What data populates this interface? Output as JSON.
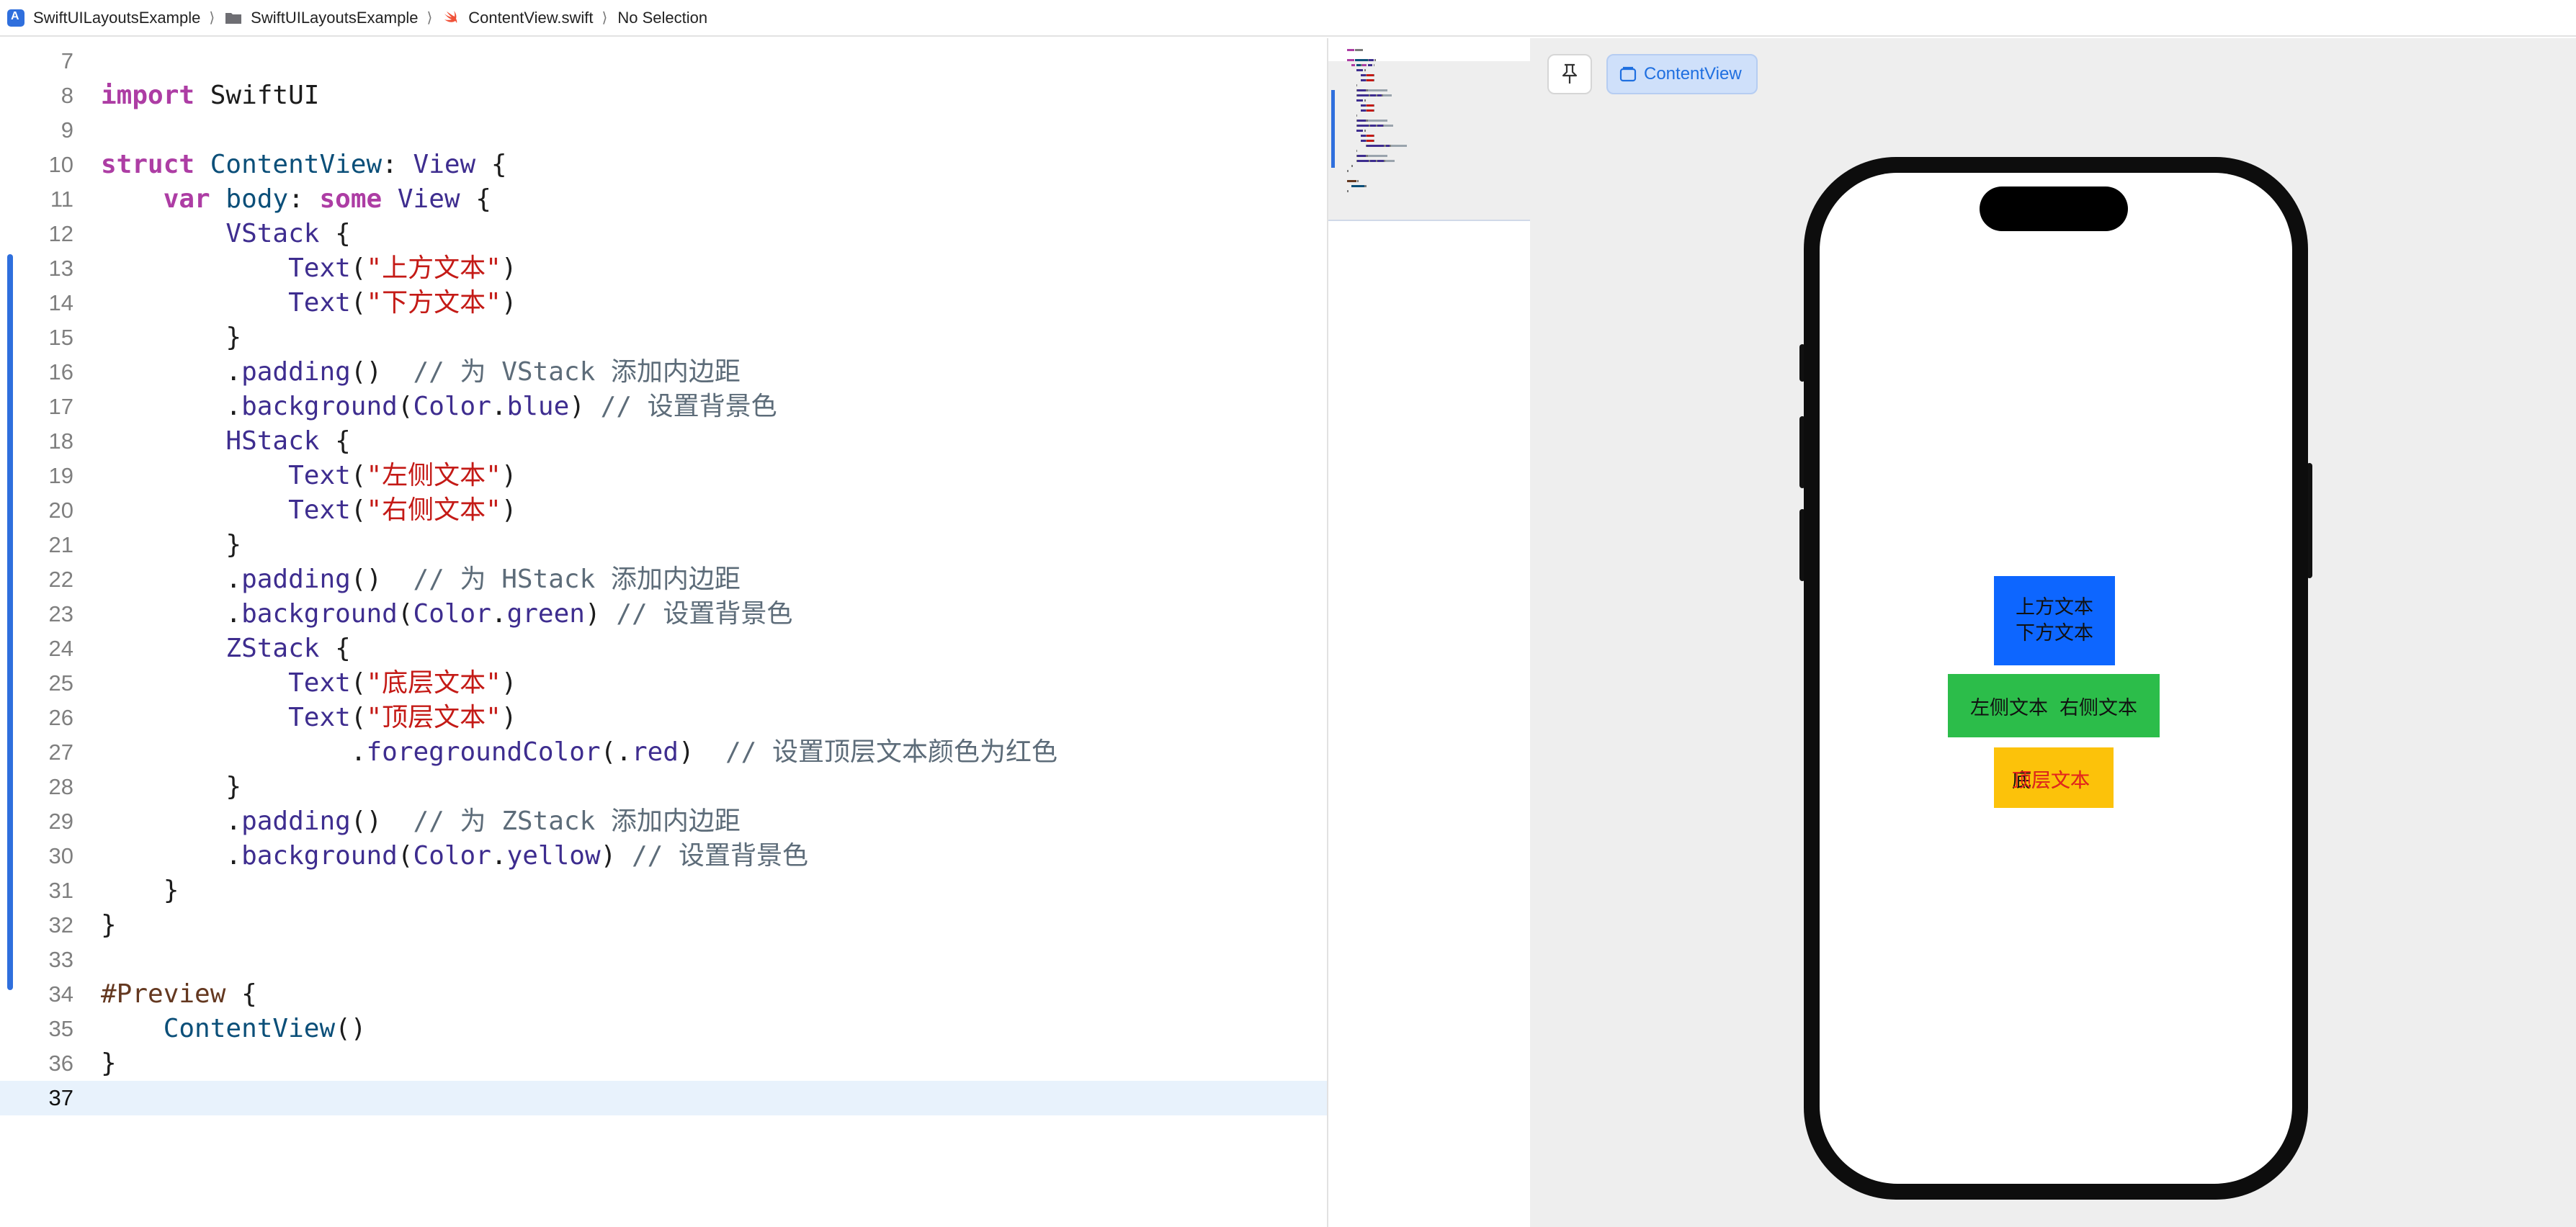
{
  "breadcrumb": {
    "project": "SwiftUILayoutsExample",
    "folder": "SwiftUILayoutsExample",
    "file": "ContentView.swift",
    "selection": "No Selection",
    "separator": "⟩"
  },
  "editor": {
    "current_line": 37,
    "lines": [
      {
        "n": "7",
        "tokens": []
      },
      {
        "n": "8",
        "tokens": [
          {
            "c": "kw",
            "t": "import"
          },
          {
            "c": "",
            "t": " SwiftUI"
          }
        ]
      },
      {
        "n": "9",
        "tokens": []
      },
      {
        "n": "10",
        "tokens": [
          {
            "c": "kw",
            "t": "struct"
          },
          {
            "c": "",
            "t": " "
          },
          {
            "c": "ty",
            "t": "ContentView"
          },
          {
            "c": "",
            "t": ": "
          },
          {
            "c": "sys",
            "t": "View"
          },
          {
            "c": "",
            "t": " {"
          }
        ]
      },
      {
        "n": "11",
        "tokens": [
          {
            "c": "",
            "t": "    "
          },
          {
            "c": "kw",
            "t": "var"
          },
          {
            "c": "",
            "t": " "
          },
          {
            "c": "ty",
            "t": "body"
          },
          {
            "c": "",
            "t": ": "
          },
          {
            "c": "kw",
            "t": "some"
          },
          {
            "c": "",
            "t": " "
          },
          {
            "c": "sys",
            "t": "View"
          },
          {
            "c": "",
            "t": " {"
          }
        ]
      },
      {
        "n": "12",
        "tokens": [
          {
            "c": "",
            "t": "        "
          },
          {
            "c": "sys",
            "t": "VStack"
          },
          {
            "c": "",
            "t": " {"
          }
        ]
      },
      {
        "n": "13",
        "tokens": [
          {
            "c": "",
            "t": "            "
          },
          {
            "c": "sys",
            "t": "Text"
          },
          {
            "c": "",
            "t": "("
          },
          {
            "c": "str",
            "t": "\"上方文本\""
          },
          {
            "c": "",
            "t": ")"
          }
        ]
      },
      {
        "n": "14",
        "tokens": [
          {
            "c": "",
            "t": "            "
          },
          {
            "c": "sys",
            "t": "Text"
          },
          {
            "c": "",
            "t": "("
          },
          {
            "c": "str",
            "t": "\"下方文本\""
          },
          {
            "c": "",
            "t": ")"
          }
        ]
      },
      {
        "n": "15",
        "tokens": [
          {
            "c": "",
            "t": "        }"
          }
        ]
      },
      {
        "n": "16",
        "tokens": [
          {
            "c": "",
            "t": "        ."
          },
          {
            "c": "prop",
            "t": "padding"
          },
          {
            "c": "",
            "t": "()  "
          },
          {
            "c": "cm",
            "t": "// 为 VStack 添加内边距"
          }
        ]
      },
      {
        "n": "17",
        "tokens": [
          {
            "c": "",
            "t": "        ."
          },
          {
            "c": "prop",
            "t": "background"
          },
          {
            "c": "",
            "t": "("
          },
          {
            "c": "sys",
            "t": "Color"
          },
          {
            "c": "",
            "t": "."
          },
          {
            "c": "prop",
            "t": "blue"
          },
          {
            "c": "",
            "t": ") "
          },
          {
            "c": "cm",
            "t": "// 设置背景色"
          }
        ]
      },
      {
        "n": "18",
        "tokens": [
          {
            "c": "",
            "t": "        "
          },
          {
            "c": "sys",
            "t": "HStack"
          },
          {
            "c": "",
            "t": " {"
          }
        ]
      },
      {
        "n": "19",
        "tokens": [
          {
            "c": "",
            "t": "            "
          },
          {
            "c": "sys",
            "t": "Text"
          },
          {
            "c": "",
            "t": "("
          },
          {
            "c": "str",
            "t": "\"左侧文本\""
          },
          {
            "c": "",
            "t": ")"
          }
        ]
      },
      {
        "n": "20",
        "tokens": [
          {
            "c": "",
            "t": "            "
          },
          {
            "c": "sys",
            "t": "Text"
          },
          {
            "c": "",
            "t": "("
          },
          {
            "c": "str",
            "t": "\"右侧文本\""
          },
          {
            "c": "",
            "t": ")"
          }
        ]
      },
      {
        "n": "21",
        "tokens": [
          {
            "c": "",
            "t": "        }"
          }
        ]
      },
      {
        "n": "22",
        "tokens": [
          {
            "c": "",
            "t": "        ."
          },
          {
            "c": "prop",
            "t": "padding"
          },
          {
            "c": "",
            "t": "()  "
          },
          {
            "c": "cm",
            "t": "// 为 HStack 添加内边距"
          }
        ]
      },
      {
        "n": "23",
        "tokens": [
          {
            "c": "",
            "t": "        ."
          },
          {
            "c": "prop",
            "t": "background"
          },
          {
            "c": "",
            "t": "("
          },
          {
            "c": "sys",
            "t": "Color"
          },
          {
            "c": "",
            "t": "."
          },
          {
            "c": "prop",
            "t": "green"
          },
          {
            "c": "",
            "t": ") "
          },
          {
            "c": "cm",
            "t": "// 设置背景色"
          }
        ]
      },
      {
        "n": "24",
        "tokens": [
          {
            "c": "",
            "t": "        "
          },
          {
            "c": "sys",
            "t": "ZStack"
          },
          {
            "c": "",
            "t": " {"
          }
        ]
      },
      {
        "n": "25",
        "tokens": [
          {
            "c": "",
            "t": "            "
          },
          {
            "c": "sys",
            "t": "Text"
          },
          {
            "c": "",
            "t": "("
          },
          {
            "c": "str",
            "t": "\"底层文本\""
          },
          {
            "c": "",
            "t": ")"
          }
        ]
      },
      {
        "n": "26",
        "tokens": [
          {
            "c": "",
            "t": "            "
          },
          {
            "c": "sys",
            "t": "Text"
          },
          {
            "c": "",
            "t": "("
          },
          {
            "c": "str",
            "t": "\"顶层文本\""
          },
          {
            "c": "",
            "t": ")"
          }
        ]
      },
      {
        "n": "27",
        "tokens": [
          {
            "c": "",
            "t": "                ."
          },
          {
            "c": "prop",
            "t": "foregroundColor"
          },
          {
            "c": "",
            "t": "(."
          },
          {
            "c": "prop",
            "t": "red"
          },
          {
            "c": "",
            "t": ")  "
          },
          {
            "c": "cm",
            "t": "// 设置顶层文本颜色为红色"
          }
        ]
      },
      {
        "n": "28",
        "tokens": [
          {
            "c": "",
            "t": "        }"
          }
        ]
      },
      {
        "n": "29",
        "tokens": [
          {
            "c": "",
            "t": "        ."
          },
          {
            "c": "prop",
            "t": "padding"
          },
          {
            "c": "",
            "t": "()  "
          },
          {
            "c": "cm",
            "t": "// 为 ZStack 添加内边距"
          }
        ]
      },
      {
        "n": "30",
        "tokens": [
          {
            "c": "",
            "t": "        ."
          },
          {
            "c": "prop",
            "t": "background"
          },
          {
            "c": "",
            "t": "("
          },
          {
            "c": "sys",
            "t": "Color"
          },
          {
            "c": "",
            "t": "."
          },
          {
            "c": "prop",
            "t": "yellow"
          },
          {
            "c": "",
            "t": ") "
          },
          {
            "c": "cm",
            "t": "// 设置背景色"
          }
        ]
      },
      {
        "n": "31",
        "tokens": [
          {
            "c": "",
            "t": "    }"
          }
        ]
      },
      {
        "n": "32",
        "tokens": [
          {
            "c": "",
            "t": "}"
          }
        ]
      },
      {
        "n": "33",
        "tokens": []
      },
      {
        "n": "34",
        "tokens": [
          {
            "c": "macro",
            "t": "#Preview"
          },
          {
            "c": "",
            "t": " {"
          }
        ]
      },
      {
        "n": "35",
        "tokens": [
          {
            "c": "",
            "t": "    "
          },
          {
            "c": "ty",
            "t": "ContentView"
          },
          {
            "c": "",
            "t": "()"
          }
        ]
      },
      {
        "n": "36",
        "tokens": [
          {
            "c": "",
            "t": "}"
          }
        ]
      },
      {
        "n": "37",
        "tokens": []
      }
    ]
  },
  "canvas": {
    "pin_icon": "pin-icon",
    "preview_chip_label": "ContentView"
  },
  "preview": {
    "vstack": {
      "top": "上方文本",
      "bottom": "下方文本",
      "color": "#0d66ff"
    },
    "hstack": {
      "left": "左侧文本",
      "right": "右侧文本",
      "color": "#2cbd4a"
    },
    "zstack": {
      "bottom_text": "底层文本",
      "top_text": "顶层文本",
      "top_color": "#e8231d",
      "color": "#fcc20a"
    }
  },
  "colors": {
    "accent": "#2f6fdd",
    "keyword": "#ad3da4",
    "string": "#c41a16",
    "comment": "#5d6c79",
    "current_line_bg": "#e8f2fc"
  }
}
